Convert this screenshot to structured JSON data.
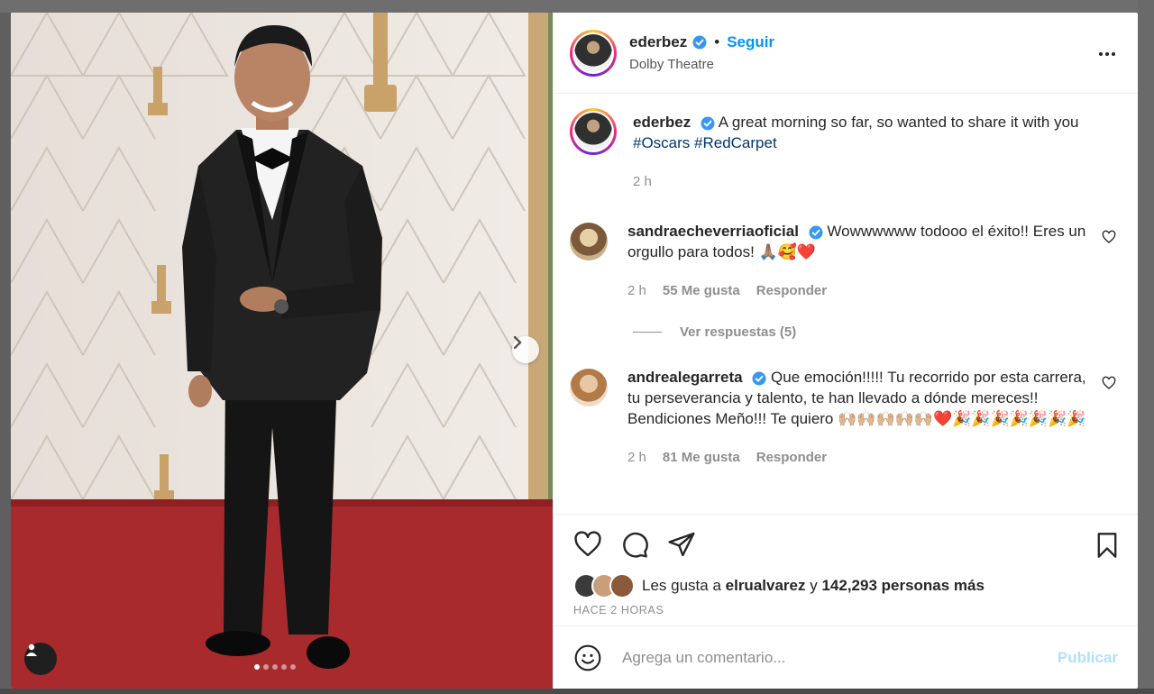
{
  "post": {
    "username": "ederbez",
    "follow_label": "Seguir",
    "separator": "•",
    "location": "Dolby Theatre",
    "caption_text": "A great morning so far, so wanted to share it with you",
    "hashtags": "#Oscars #RedCarpet",
    "caption_time": "2 h",
    "carousel_total": 5,
    "carousel_index": 1
  },
  "comments": [
    {
      "username": "sandraecheverriaoficial",
      "text": "Wowwwwww todooo el éxito!! Eres un orgullo para todos! 🙏🏽🥰❤️",
      "time": "2 h",
      "likes": "55 Me gusta",
      "reply_label": "Responder",
      "view_replies": "Ver respuestas (5)"
    },
    {
      "username": "andrealegarreta",
      "text": "Que emoción!!!!! Tu recorrido por esta carrera, tu perseverancia y talento, te han llevado a dónde mereces!! Bendiciones Meño!!! Te quiero 🙌🏼🙌🏼🙌🏼🙌🏼🙌🏼❤️🎉🎉🎉🎉🎉🎉🎉",
      "time": "2 h",
      "likes": "81 Me gusta",
      "reply_label": "Responder"
    }
  ],
  "likes_summary": {
    "prefix": "Les gusta a",
    "user": "elrualvarez",
    "conj": "y",
    "count": "142,293 personas más"
  },
  "posted_ago": "HACE 2 HORAS",
  "composer": {
    "placeholder": "Agrega un comentario...",
    "publish_label": "Publicar"
  },
  "colors": {
    "accent": "#0095f6",
    "verified": "#3897f0",
    "hashtag": "#00376b",
    "publish_disabled": "#b2dffc"
  },
  "icons": [
    "verified-badge-icon",
    "more-options-icon",
    "heart-icon",
    "comment-icon",
    "share-icon",
    "save-icon",
    "emoji-icon",
    "chevron-right-icon",
    "user-tag-icon"
  ]
}
